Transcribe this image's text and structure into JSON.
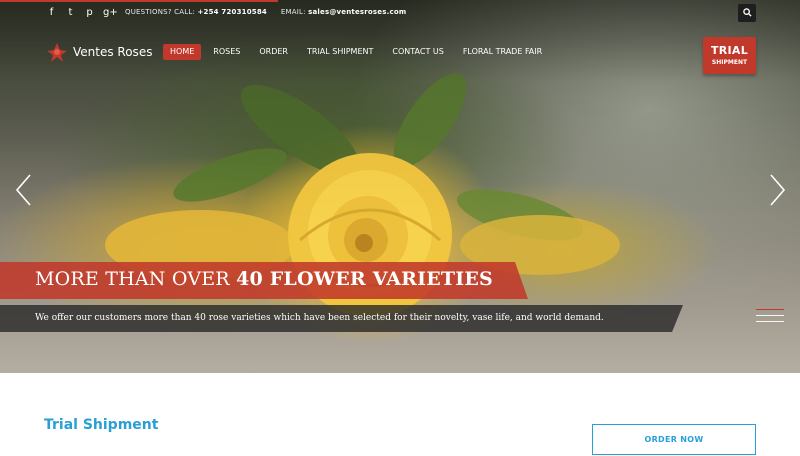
{
  "topbar": {
    "social_icons": [
      "facebook-icon",
      "twitter-icon",
      "pinterest-icon",
      "google-plus-icon"
    ],
    "social_glyphs": [
      "f",
      "t",
      "p",
      "g+"
    ],
    "questions_label": "QUESTIONS? CALL:",
    "phone": "+254 720310584",
    "email_label": "EMAIL:",
    "email": "sales@ventesroses.com",
    "search_icon": "search-icon"
  },
  "brand": {
    "name": "Ventes Roses",
    "accent": "#c0392b",
    "link_blue": "#2a9fd6"
  },
  "nav": {
    "items": [
      {
        "label": "HOME",
        "active": true
      },
      {
        "label": "ROSES",
        "active": false
      },
      {
        "label": "ORDER",
        "active": false
      },
      {
        "label": "TRIAL SHIPMENT",
        "active": false
      },
      {
        "label": "CONTACT US",
        "active": false
      },
      {
        "label": "FLORAL TRADE FAIR",
        "active": false
      }
    ]
  },
  "trial_badge": {
    "line1": "TRIAL",
    "line2": "SHIPMENT"
  },
  "slider": {
    "title_prefix": "MORE THAN OVER ",
    "title_bold": "40 FLOWER VARIETIES",
    "subtitle": "We offer our customers more than 40 rose varieties which have been selected for their novelty, vase life, and world demand.",
    "prev_icon": "chevron-left-icon",
    "next_icon": "chevron-right-icon"
  },
  "section": {
    "title": "Trial Shipment",
    "order_button": "ORDER NOW"
  }
}
